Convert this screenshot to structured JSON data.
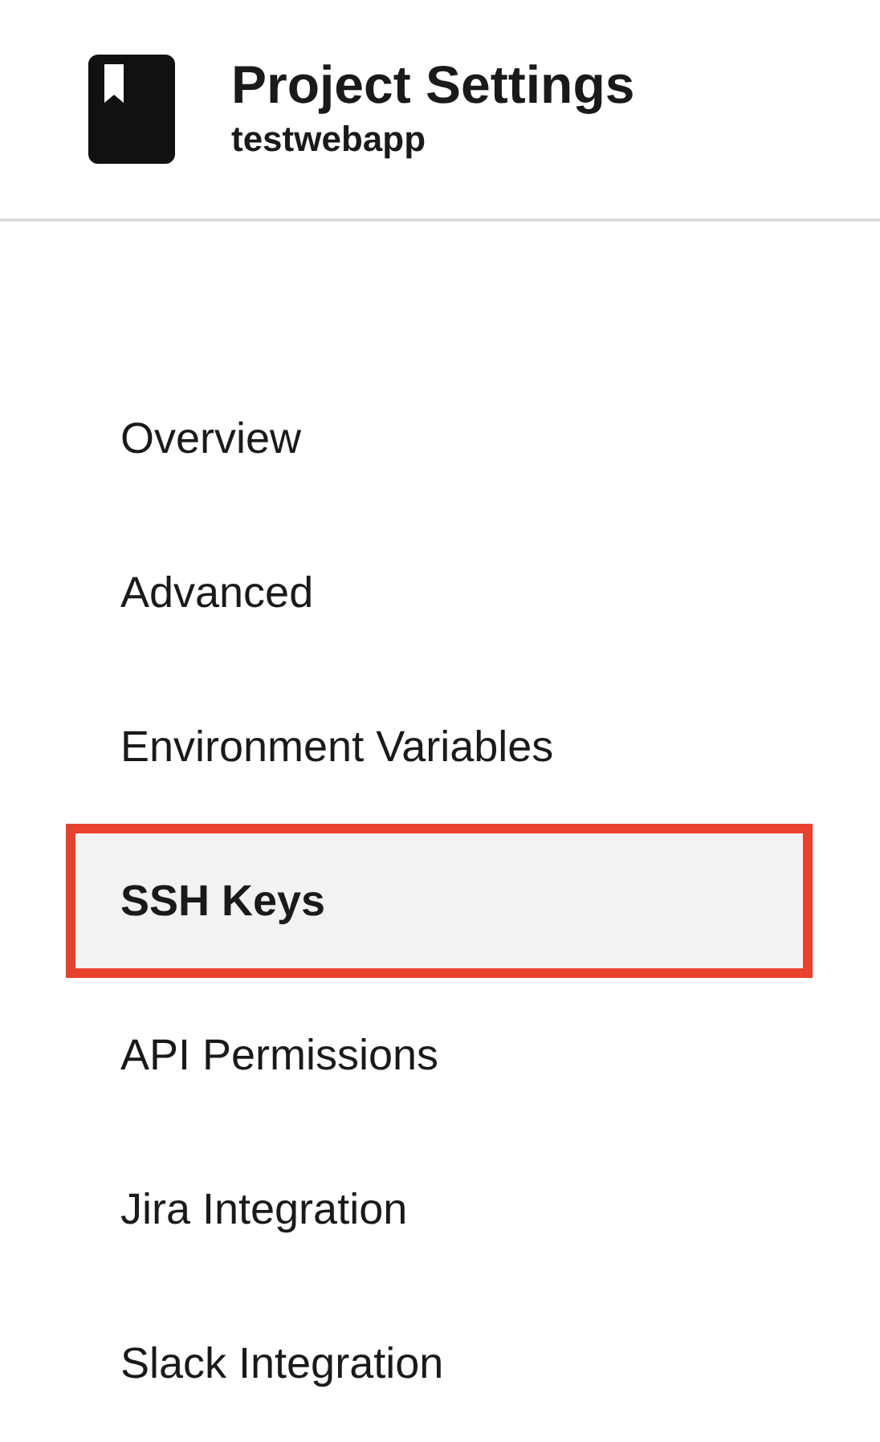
{
  "header": {
    "title": "Project Settings",
    "subtitle": "testwebapp"
  },
  "nav": [
    {
      "label": "Overview",
      "selected": false,
      "highlighted": false
    },
    {
      "label": "Advanced",
      "selected": false,
      "highlighted": false
    },
    {
      "label": "Environment Variables",
      "selected": false,
      "highlighted": false
    },
    {
      "label": "SSH Keys",
      "selected": true,
      "highlighted": true
    },
    {
      "label": "API Permissions",
      "selected": false,
      "highlighted": false
    },
    {
      "label": "Jira Integration",
      "selected": false,
      "highlighted": false
    },
    {
      "label": "Slack Integration",
      "selected": false,
      "highlighted": false
    }
  ]
}
